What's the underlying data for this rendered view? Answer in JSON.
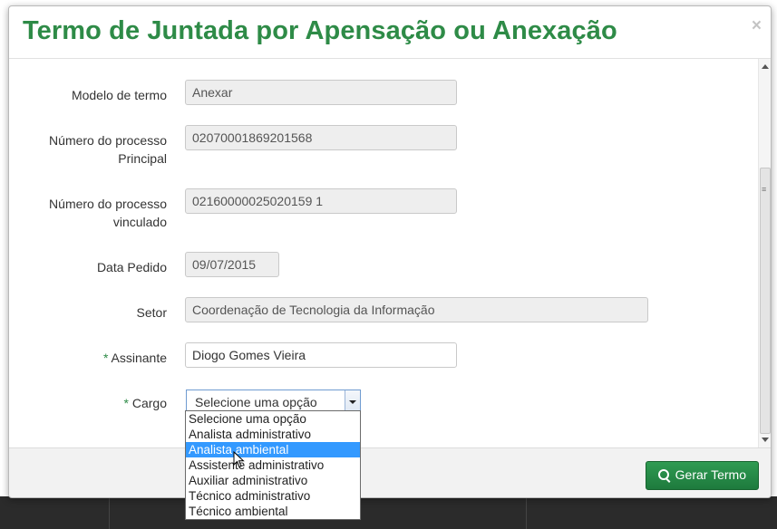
{
  "modal": {
    "title": "Termo de Juntada por Apensação ou Anexação",
    "close_icon": "×"
  },
  "form": {
    "modelo": {
      "label": "Modelo de termo",
      "value": "Anexar"
    },
    "processo_principal": {
      "label_line1": "Número do processo",
      "label_line2": "Principal",
      "value": "02070001869201568"
    },
    "processo_vinculado": {
      "label_line1": "Número do processo",
      "label_line2": "vinculado",
      "value": "02160000025020159 1"
    },
    "data_pedido": {
      "label": "Data Pedido",
      "value": "09/07/2015"
    },
    "setor": {
      "label": "Setor",
      "value": "Coordenação de Tecnologia da Informação"
    },
    "assinante": {
      "required_mark": "*",
      "label": "Assinante",
      "value": "Diogo Gomes Vieira"
    },
    "cargo": {
      "required_mark": "*",
      "label": "Cargo",
      "selected": "Selecione uma opção",
      "options": [
        "Selecione uma opção",
        "Analista administrativo",
        "Analista ambiental",
        "Assistente administrativo",
        "Auxiliar administrativo",
        "Técnico administrativo",
        "Técnico ambiental"
      ],
      "highlighted_index": 2
    }
  },
  "footer": {
    "generate_button": "Gerar Termo",
    "generate_icon": "search-icon"
  },
  "colors": {
    "title_green": "#2e8b47",
    "button_green": "#1e7a3d",
    "highlight_blue": "#3399ff"
  }
}
